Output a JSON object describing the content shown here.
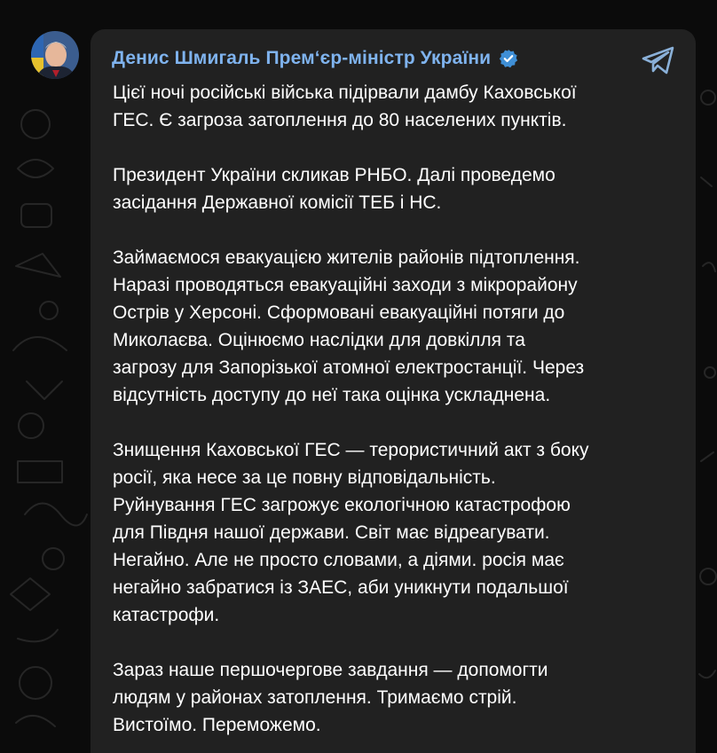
{
  "post": {
    "author": "Денис Шмигаль Прем‘єр-міністр України",
    "paragraphs": [
      "Цієї ночі російські війська підірвали дамбу Каховської\nГЕС. Є загроза затоплення до 80 населених пунктів.",
      "Президент України скликав РНБО. Далі проведемо\nзасідання Державної комісії ТЕБ і НС.",
      "Займаємося евакуацією жителів районів підтоплення.\nНаразі проводяться евакуаційні заходи з мікрорайону\nОстрів у Херсоні. Сформовані евакуаційні потяги до\nМиколаєва. Оцінюємо наслідки для довкілля та\nзагрозу для Запорізької атомної електростанції. Через\nвідсутність доступу до неї така оцінка ускладнена.",
      "Знищення Каховської ГЕС — терористичний акт з боку\nросії, яка несе за це повну відповідальність.\nРуйнування ГЕС загрожує екологічною катастрофою\nдля Півдня нашої держави. Світ має відреагувати.\nНегайно. Але не просто словами, а діями. росія має\nнегайно забратися із ЗАЕС, аби уникнути подальшої\nкатастрофи.",
      "Зараз наше першочергове завдання — допомогти\nлюдям у районах затоплення. Тримаємо стрій.\nВистоїмо. Переможемо."
    ]
  },
  "icons": {
    "verified": "verified-badge-icon",
    "share": "telegram-share-icon",
    "avatar": "author-avatar"
  },
  "colors": {
    "background": "#0b0b0b",
    "bubble": "#212121",
    "author": "#7fb3ee",
    "text": "#ffffff",
    "verified": "#3f8fd6"
  }
}
